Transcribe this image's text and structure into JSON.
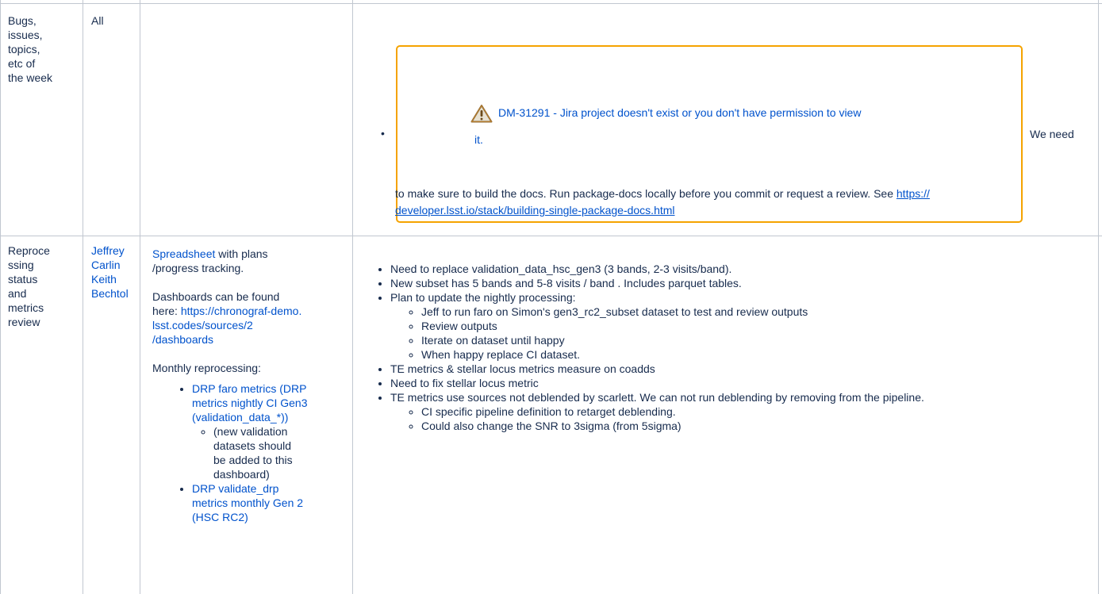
{
  "row1": {
    "topic": [
      "Bugs,",
      "issues,",
      "topics,",
      "etc of",
      "the week"
    ],
    "who": "All",
    "jira": {
      "key": "DM-31291",
      "message_line1": " - Jira project doesn't exist or you don't have permission to view",
      "message_line2": "it.",
      "icon": "warning-triangle-icon",
      "border_color": "#f5a300"
    },
    "we_need": "We need",
    "text_before_link": "to make sure to build the docs. Run package-docs locally before you commit or request a review. See ",
    "link": "https://developer.lsst.io/stack/building-single-package-docs.html",
    "link_line1": "https://",
    "link_line2": "developer.lsst.io/stack/building-single-package-docs.html"
  },
  "row2": {
    "topic": [
      "Reproce",
      "ssing",
      "status",
      "and",
      "metrics",
      "review"
    ],
    "who": [
      "Jeffrey",
      "Carlin",
      "Keith",
      "Bechtol"
    ],
    "notes": {
      "spreadsheet_link": "Spreadsheet",
      "spreadsheet_after": " with plans",
      "spreadsheet_line2": "/progress tracking.",
      "dash_line1": "Dashboards can be found",
      "dash_line2_prefix": "here: ",
      "dash_url_line1": "https://chronograf-demo.",
      "dash_url_line2": "lsst.codes/sources/2",
      "dash_url_line3": "/dashboards",
      "monthly": "Monthly reprocessing:",
      "link1_lines": [
        "DRP faro metrics (DRP",
        "metrics nightly CI Gen3",
        "(validation_data_*))"
      ],
      "sub1_lines": [
        "(new validation",
        "datasets should",
        "be added to this",
        "dashboard)"
      ],
      "link2_lines": [
        "DRP validate_drp",
        "metrics monthly Gen 2",
        "(HSC RC2)"
      ]
    },
    "items": [
      {
        "text": "Need to replace validation_data_hsc_gen3  (3 bands, 2-3 visits/band).",
        "sub": []
      },
      {
        "text": "New subset has 5 bands and 5-8 visits / band . Includes parquet tables.",
        "sub": []
      },
      {
        "text": "Plan to update the nightly processing:",
        "sub": [
          "Jeff to run faro on Simon's gen3_rc2_subset dataset to test and review outputs",
          "Review outputs",
          "Iterate on dataset until happy",
          "When happy  replace CI dataset."
        ]
      },
      {
        "text": "TE metrics & stellar locus metrics measure on coadds",
        "sub": []
      },
      {
        "text": "Need to fix stellar locus metric",
        "sub": []
      },
      {
        "text": "TE metrics use sources not deblended by scarlett. We can not run deblending by removing from the pipeline.",
        "sub": [
          "CI specific pipeline definition to retarget deblending.",
          "Could also change the SNR to 3sigma (from 5sigma)"
        ]
      }
    ]
  }
}
